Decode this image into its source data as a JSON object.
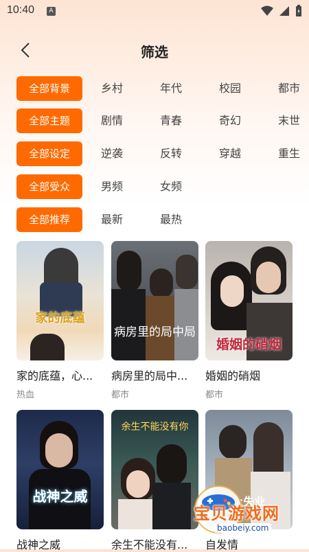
{
  "status": {
    "time": "10:40",
    "a_icon": "A"
  },
  "header": {
    "title": "筛选"
  },
  "filters": [
    {
      "chip": "全部背景",
      "options": [
        "乡村",
        "年代",
        "校园",
        "都市"
      ]
    },
    {
      "chip": "全部主题",
      "options": [
        "剧情",
        "青春",
        "奇幻",
        "末世"
      ]
    },
    {
      "chip": "全部设定",
      "options": [
        "逆袭",
        "反转",
        "穿越",
        "重生"
      ]
    },
    {
      "chip": "全部受众",
      "options": [
        "男频",
        "女频"
      ]
    },
    {
      "chip": "全部推荐",
      "options": [
        "最新",
        "最热"
      ]
    }
  ],
  "cards": [
    {
      "title": "家的底蕴，心...",
      "tag": "热血",
      "poster_text": "家的底蕴"
    },
    {
      "title": "病房里的局中...",
      "tag": "都市",
      "poster_text": "病房里的局中局"
    },
    {
      "title": "婚姻的硝烟",
      "tag": "都市",
      "poster_text": "婚姻的硝烟"
    },
    {
      "title": "战神之威",
      "tag": "",
      "poster_text": "战神之威"
    },
    {
      "title": "余生不能没有...",
      "tag": "",
      "poster_text": "余生不能没有你"
    },
    {
      "title": "自发情",
      "tag": "",
      "poster_text": "上失业"
    }
  ],
  "watermark": {
    "text": "宝贝游戏网",
    "url": "baobeiy.com"
  },
  "colors": {
    "accent": "#ff6a00"
  }
}
